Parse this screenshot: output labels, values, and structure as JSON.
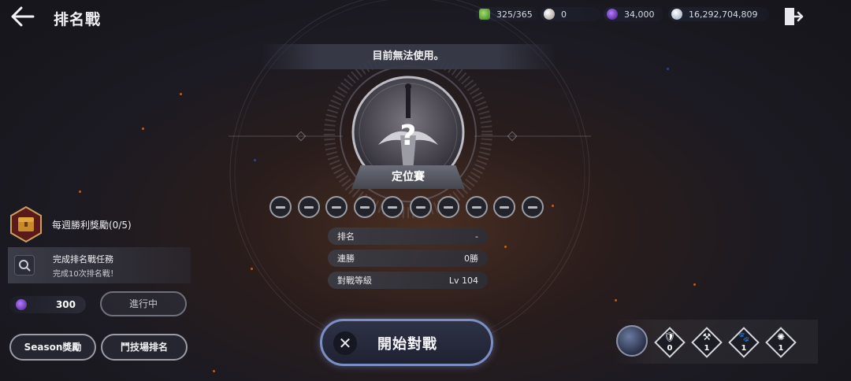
{
  "header": {
    "title": "排名戰",
    "resources": [
      {
        "name": "stamina",
        "icon": "green-gem-icon",
        "value": "325/365",
        "color": "#5fbf3a"
      },
      {
        "name": "pearl",
        "icon": "pearl-icon",
        "value": "0",
        "color": "#d9d2cc"
      },
      {
        "name": "purple-crystal",
        "icon": "purple-crystal-icon",
        "value": "34,000",
        "color": "#8a4cff"
      },
      {
        "name": "silver",
        "icon": "silver-coin-icon",
        "value": "16,292,704,809",
        "color": "#c8d4e4"
      }
    ]
  },
  "center": {
    "notice": "目前無法使用。",
    "rank_banner": "定位賽",
    "placement_slots": 10,
    "stats": [
      {
        "label": "排名",
        "value": "-"
      },
      {
        "label": "連勝",
        "value": "0勝"
      },
      {
        "label": "對戰等級",
        "value": "Lv 104"
      }
    ],
    "start_button": "開始對戰"
  },
  "left_panel": {
    "weekly_reward_title": "每週勝利獎勵(0/5)",
    "mission_title": "完成排名戰任務",
    "mission_desc": "完成10次排名戰！",
    "reward_value": "300",
    "progress_button": "進行中",
    "season_button": "Season獎勵",
    "arena_button": "鬥技場排名"
  },
  "skills": [
    {
      "icon": "shield-icon",
      "glyph": "🛡",
      "count": "0"
    },
    {
      "icon": "hammer-icon",
      "glyph": "⚒",
      "count": "1"
    },
    {
      "icon": "paw-icon",
      "glyph": "🐾",
      "count": "1"
    },
    {
      "icon": "sun-icon",
      "glyph": "✺",
      "count": "1"
    }
  ]
}
